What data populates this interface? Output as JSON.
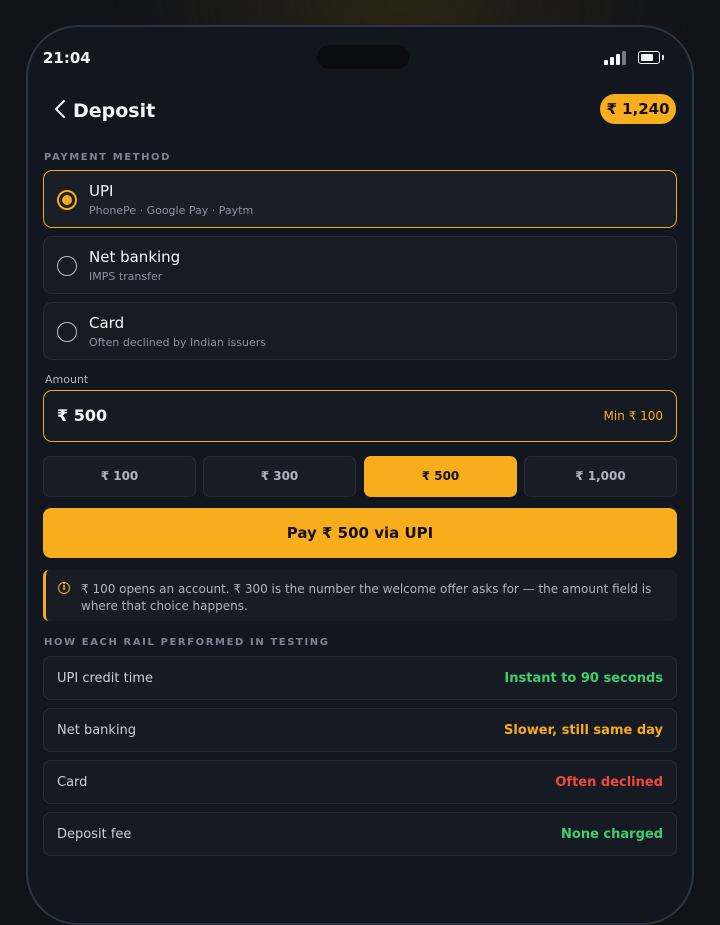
{
  "status_bar": {
    "time": "21:04"
  },
  "header": {
    "title": "Deposit",
    "balance": "₹ 1,240"
  },
  "payment_method": {
    "section_label": "PAYMENT METHOD",
    "options": [
      {
        "title": "UPI",
        "subtitle": "PhonePe · Google Pay · Paytm",
        "selected": true
      },
      {
        "title": "Net banking",
        "subtitle": "IMPS transfer",
        "selected": false
      },
      {
        "title": "Card",
        "subtitle": "Often declined by Indian issuers",
        "selected": false
      }
    ]
  },
  "amount": {
    "label": "Amount",
    "value": "₹ 500",
    "min_hint": "Min ₹ 100",
    "chips": [
      {
        "label": "₹ 100",
        "active": false
      },
      {
        "label": "₹ 300",
        "active": false
      },
      {
        "label": "₹ 500",
        "active": true
      },
      {
        "label": "₹ 1,000",
        "active": false
      }
    ]
  },
  "pay_button": {
    "label": "Pay ₹ 500 via UPI"
  },
  "note": {
    "text": "₹ 100 opens an account. ₹ 300 is the number the welcome offer asks for — the amount field is where that choice happens."
  },
  "rails": {
    "section_label": "HOW EACH RAIL PERFORMED IN TESTING",
    "rows": [
      {
        "label": "UPI credit time",
        "value": "Instant to 90 seconds",
        "color": "#3fcf6e"
      },
      {
        "label": "Net banking",
        "value": "Slower, still same day",
        "color": "#f6ab1d"
      },
      {
        "label": "Card",
        "value": "Often declined",
        "color": "#f0483e"
      },
      {
        "label": "Deposit fee",
        "value": "None charged",
        "color": "#3fcf6e"
      }
    ]
  },
  "colors": {
    "accent": "#f8ad1c",
    "background": "#12161e"
  }
}
